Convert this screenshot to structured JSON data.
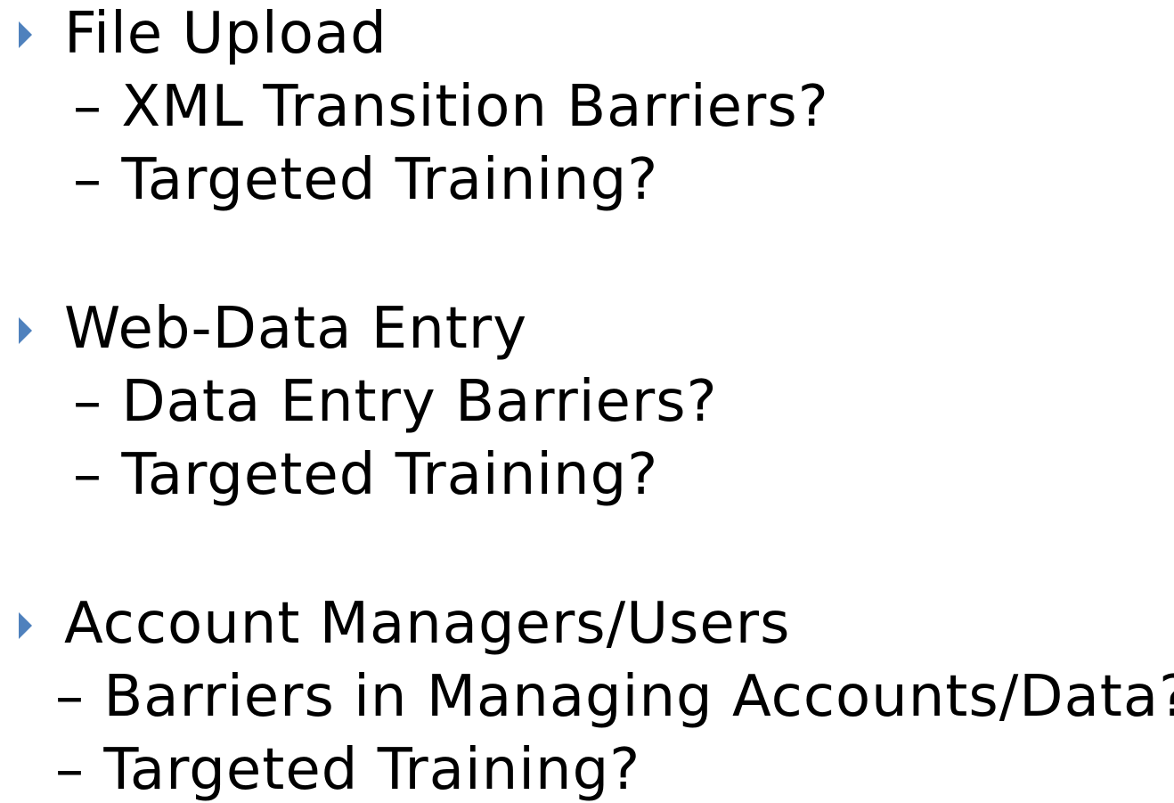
{
  "accent_color": "#4f81bd",
  "sections": [
    {
      "heading": "File Upload",
      "bullet_icon": "triangle-right-icon",
      "subitems": [
        "XML Transition Barriers?",
        "Targeted Training?"
      ]
    },
    {
      "heading": "Web-Data Entry",
      "bullet_icon": "triangle-right-icon",
      "subitems": [
        "Data Entry Barriers?",
        "Targeted Training?"
      ]
    },
    {
      "heading": "Account Managers/Users",
      "bullet_icon": "triangle-right-icon",
      "subitems": [
        "Barriers in Managing Accounts/Data?",
        "Targeted Training?"
      ]
    }
  ],
  "dash": "–"
}
